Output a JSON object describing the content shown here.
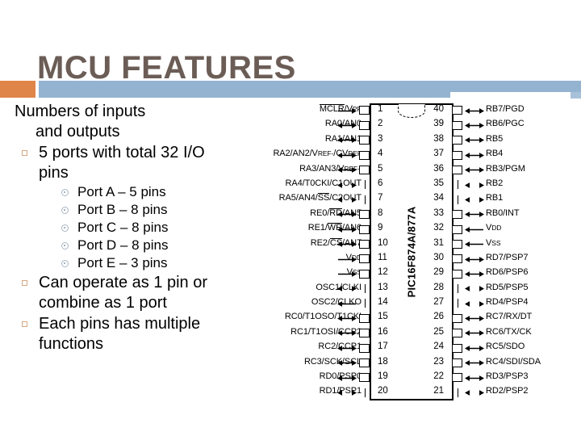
{
  "slide": {
    "title": "MCU FEATURES",
    "title_color": "#6b5d56",
    "accent_orange": "#e0854a",
    "accent_blue": "#93b3d1"
  },
  "body": {
    "lead_line1": "Numbers of inputs",
    "lead_line2": "and outputs",
    "bullets": [
      {
        "text": "5 ports with total 32 I/O pins",
        "sub": [
          "Port A – 5 pins",
          "Port B – 8 pins",
          "Port C – 8 pins",
          "Port D – 8 pins",
          "Port E – 3 pins"
        ]
      },
      {
        "text": "Can operate as 1 pin or combine as 1 port",
        "sub": []
      },
      {
        "text": "Each pins has multiple functions",
        "sub": []
      }
    ]
  },
  "diagram": {
    "chip_label": "PIC16F874A/877A",
    "notch": "package-notch",
    "rows": [
      {
        "num_l": "1",
        "num_r": "40",
        "left": "MCLR/VPP",
        "right": "RB7/PGD",
        "arrow_l": "in",
        "arrow_r": "bi",
        "pad_l": "box",
        "pad_r": "box"
      },
      {
        "num_l": "2",
        "num_r": "39",
        "left": "RA0/AN0",
        "right": "RB6/PGC",
        "arrow_l": "bi",
        "arrow_r": "bi",
        "pad_l": "box",
        "pad_r": "box"
      },
      {
        "num_l": "3",
        "num_r": "38",
        "left": "RA1/AN1",
        "right": "RB5",
        "arrow_l": "bi",
        "arrow_r": "bi",
        "pad_l": "box",
        "pad_r": "box"
      },
      {
        "num_l": "4",
        "num_r": "37",
        "left": "RA2/AN2/VREF-/CVREF",
        "right": "RB4",
        "arrow_l": "bi",
        "arrow_r": "bi",
        "pad_l": "box",
        "pad_r": "box"
      },
      {
        "num_l": "5",
        "num_r": "36",
        "left": "RA3/AN3/VREF+",
        "right": "RB3/PGM",
        "arrow_l": "bi",
        "arrow_r": "bi",
        "pad_l": "box",
        "pad_r": "box"
      },
      {
        "num_l": "6",
        "num_r": "35",
        "left": "RA4/T0CKI/C1OUT",
        "right": "RB2",
        "arrow_l": "split",
        "arrow_r": "split",
        "pad_l": "line",
        "pad_r": "line"
      },
      {
        "num_l": "7",
        "num_r": "34",
        "left": "RA5/AN4/SS/C2OUT",
        "right": "RB1",
        "arrow_l": "split",
        "arrow_r": "split",
        "pad_l": "line",
        "pad_r": "line"
      },
      {
        "num_l": "8",
        "num_r": "33",
        "left": "RE0/RD/AN5",
        "right": "RB0/INT",
        "arrow_l": "bi",
        "arrow_r": "bi",
        "pad_l": "box",
        "pad_r": "box"
      },
      {
        "num_l": "9",
        "num_r": "32",
        "left": "RE1/WR/AN6",
        "right": "VDD",
        "arrow_l": "bi",
        "arrow_r": "in",
        "pad_l": "box",
        "pad_r": "box"
      },
      {
        "num_l": "10",
        "num_r": "31",
        "left": "RE2/CS/AN7",
        "right": "VSS",
        "arrow_l": "bi",
        "arrow_r": "in",
        "pad_l": "box",
        "pad_r": "box"
      },
      {
        "num_l": "11",
        "num_r": "30",
        "left": "VDD",
        "right": "RD7/PSP7",
        "arrow_l": "in",
        "arrow_r": "bi",
        "pad_l": "box",
        "pad_r": "box"
      },
      {
        "num_l": "12",
        "num_r": "29",
        "left": "VSS",
        "right": "RD6/PSP6",
        "arrow_l": "in",
        "arrow_r": "bi",
        "pad_l": "box",
        "pad_r": "box"
      },
      {
        "num_l": "13",
        "num_r": "28",
        "left": "OSC1/CLKI",
        "right": "RD5/PSP5",
        "arrow_l": "split",
        "arrow_r": "split",
        "pad_l": "line",
        "pad_r": "line"
      },
      {
        "num_l": "14",
        "num_r": "27",
        "left": "OSC2/CLKO",
        "right": "RD4/PSP4",
        "arrow_l": "out",
        "arrow_r": "split",
        "pad_l": "line",
        "pad_r": "line"
      },
      {
        "num_l": "15",
        "num_r": "26",
        "left": "RC0/T1OSO/T1CKI",
        "right": "RC7/RX/DT",
        "arrow_l": "bi",
        "arrow_r": "bi",
        "pad_l": "box",
        "pad_r": "box"
      },
      {
        "num_l": "16",
        "num_r": "25",
        "left": "RC1/T1OSI/CCP2",
        "right": "RC6/TX/CK",
        "arrow_l": "bi",
        "arrow_r": "bi",
        "pad_l": "box",
        "pad_r": "box"
      },
      {
        "num_l": "17",
        "num_r": "24",
        "left": "RC2/CCP1",
        "right": "RC5/SDO",
        "arrow_l": "bi",
        "arrow_r": "bi",
        "pad_l": "box",
        "pad_r": "box"
      },
      {
        "num_l": "18",
        "num_r": "23",
        "left": "RC3/SCK/SCL",
        "right": "RC4/SDI/SDA",
        "arrow_l": "bi",
        "arrow_r": "bi",
        "pad_l": "box",
        "pad_r": "box"
      },
      {
        "num_l": "19",
        "num_r": "22",
        "left": "RD0/PSP0",
        "right": "RD3/PSP3",
        "arrow_l": "bi",
        "arrow_r": "bi",
        "pad_l": "box",
        "pad_r": "box"
      },
      {
        "num_l": "20",
        "num_r": "21",
        "left": "RD1/PSP1",
        "right": "RD2/PSP2",
        "arrow_l": "split",
        "arrow_r": "split",
        "pad_l": "line",
        "pad_r": "line"
      }
    ]
  }
}
